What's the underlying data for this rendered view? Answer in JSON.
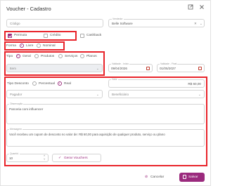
{
  "window": {
    "title": "Voucher - Cadastro"
  },
  "top_row": {
    "codigo_placeholder": "Código",
    "vendedor_label": "Vendedor",
    "vendedor_value": "Belle Software"
  },
  "types": {
    "permuta": "Permuta",
    "credito": "Crédito",
    "cashback": "Cashback"
  },
  "forma": {
    "label": "Forma",
    "livre": "Livre",
    "nominal": "Nominal"
  },
  "tipo": {
    "label": "Tipo",
    "options": [
      "Geral",
      "Produtos",
      "Serviços",
      "Planos"
    ],
    "selected": "Geral",
    "item_placeholder": "Item"
  },
  "validade": {
    "inicio_label": "Validade - Início",
    "inicio_value": "09/04/2026",
    "final_label": "Validade - Final",
    "final_value": "01/05/2027"
  },
  "desconto": {
    "label": "Tipo Desconto",
    "percentual": "Percentual",
    "real": "Real",
    "valor_label": "Valor",
    "valor_value": "R$ 60,00"
  },
  "pagador": {
    "placeholder": "Pagador",
    "beneficiario_placeholder": "Beneficiário"
  },
  "observacao": {
    "label": "Observação",
    "value": "Parceria com influencer"
  },
  "mensagem": {
    "label": "Mensagem",
    "value": "Você recebeu um cupom de desconto no valor de: R$ 60,00 para aquisição de qualquer produto, serviço ou plano"
  },
  "quantidade": {
    "label": "Quantid.",
    "value": "10"
  },
  "buttons": {
    "gerar": "Gerar Vouchers",
    "cancelar": "Cancelar",
    "salvar": "Salvar"
  },
  "colors": {
    "accent": "#9b2a7d",
    "highlight": "#e8232a"
  }
}
